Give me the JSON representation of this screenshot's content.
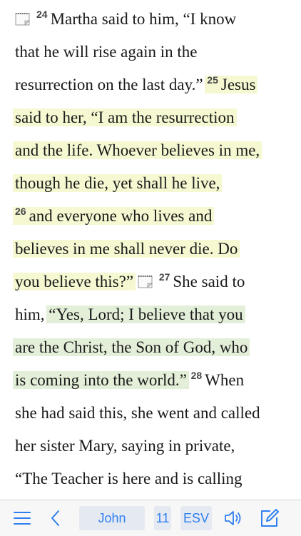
{
  "reader": {
    "lines": [
      {
        "note_before": true,
        "verse": "24",
        "text": "Martha said to him, “I know"
      },
      {
        "text": "that he will rise again in the"
      },
      {
        "text": "resurrection on the last day.”",
        "verse_after": "25",
        "hl_text": "Jesus"
      },
      {
        "hl_text": "said to her, “I am the resurrection"
      },
      {
        "hl_text": "and the life. Whoever believes in me,"
      },
      {
        "hl_text": "though he die, yet shall he live,"
      },
      {
        "hl_verse": "26",
        "hl_text": "and everyone who lives and"
      },
      {
        "hl_text": "believes in me shall never die. Do"
      },
      {
        "hl_text": "you believe this?”",
        "note_after": true,
        "verse_after": "27",
        "text_after": "She said to"
      },
      {
        "text": "him,",
        "green_text": "“Yes, Lord; I believe that you"
      },
      {
        "green_text": "are the Christ, the Son of God, who"
      },
      {
        "green_text": "is coming into the world.”",
        "verse_after": "28",
        "text_after": "When"
      },
      {
        "text": "she had said this, she went and called"
      },
      {
        "text": "her sister Mary, saying in private,"
      },
      {
        "text": "“The Teacher is here and is calling"
      }
    ],
    "highlight_colors": {
      "yellow": "#f6f8d2",
      "green": "#e3efd9"
    }
  },
  "toolbar": {
    "menu_icon": "menu-icon",
    "back_icon": "chevron-left-icon",
    "book": "John",
    "chapter": "11",
    "translation": "ESV",
    "audio_icon": "speaker-icon",
    "edit_icon": "compose-icon",
    "accent": "#2f7ff0"
  }
}
